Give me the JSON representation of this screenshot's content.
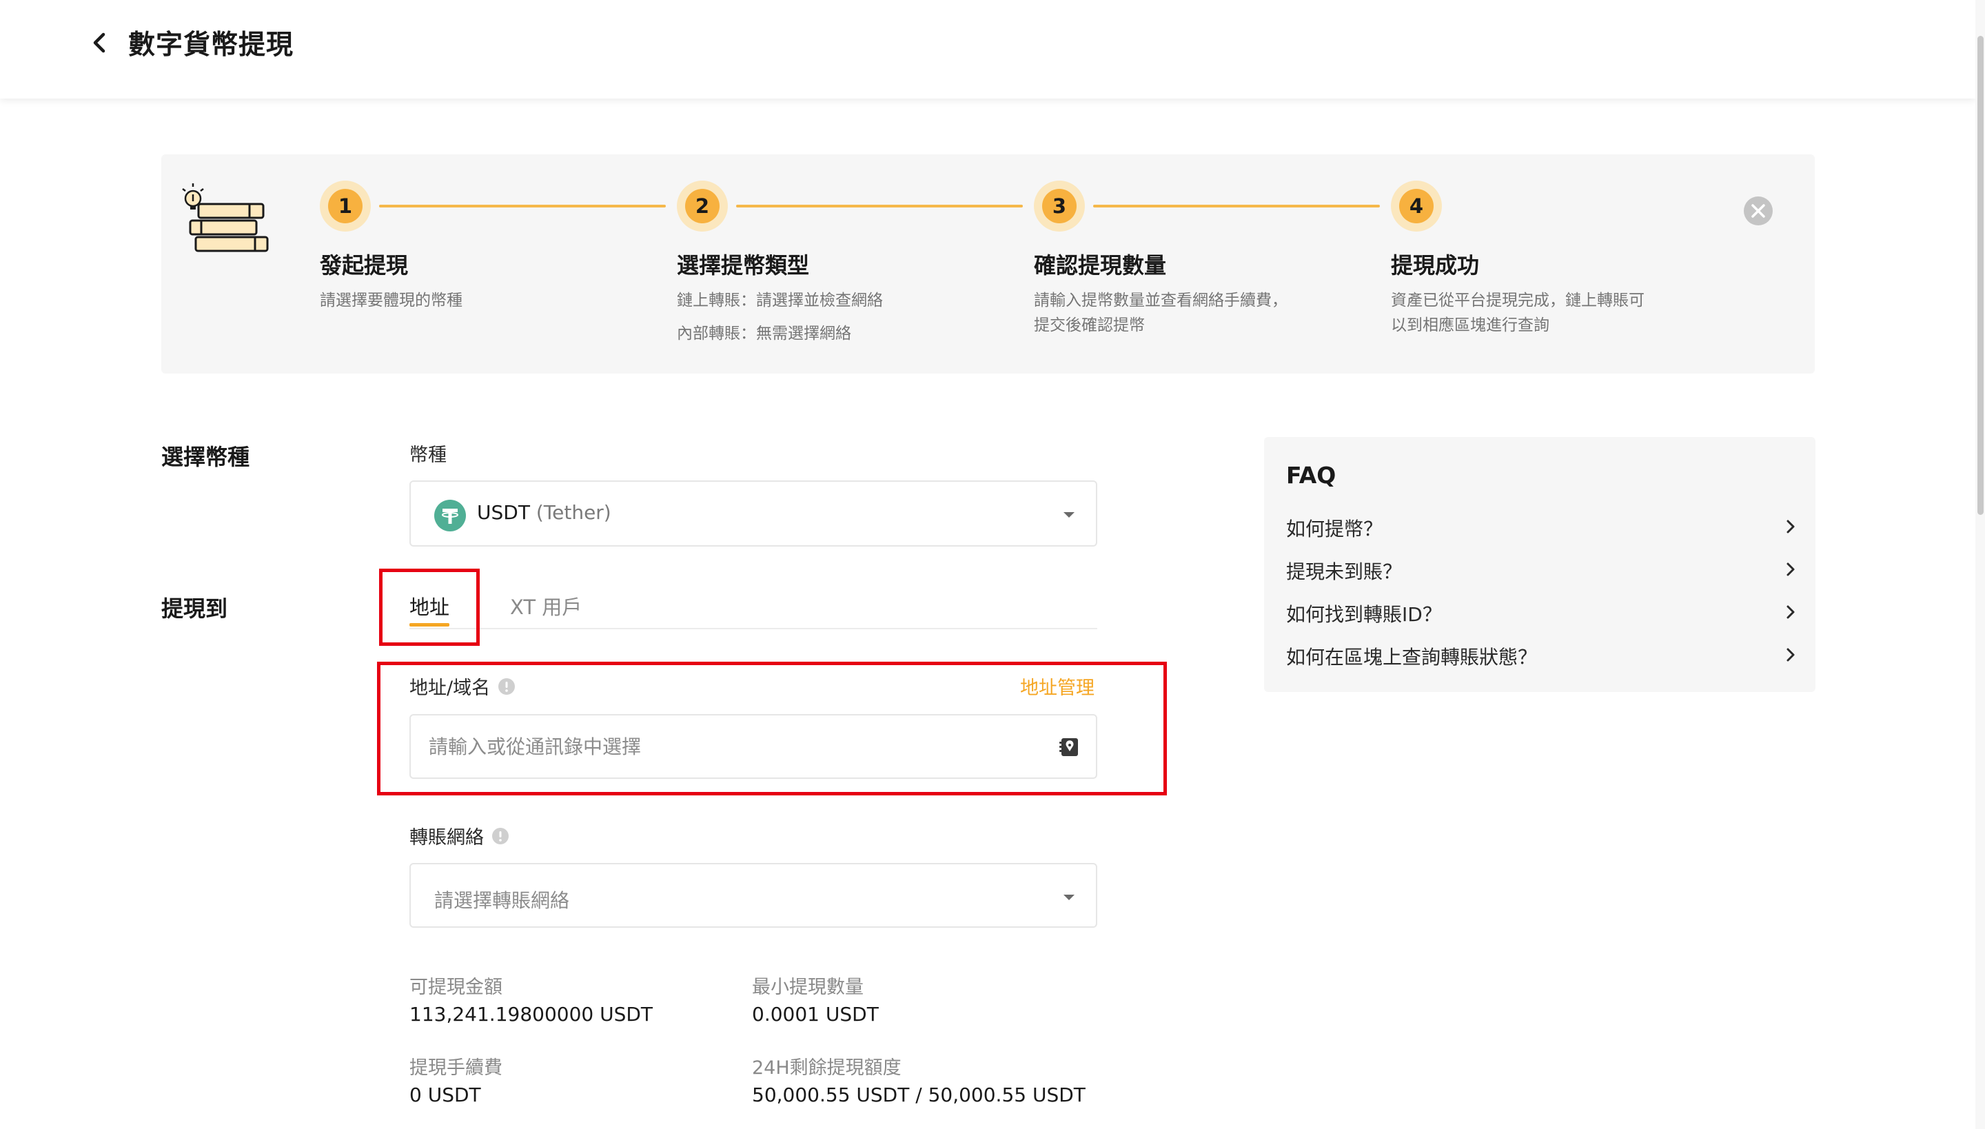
{
  "header": {
    "title": "數字貨幣提現",
    "back_icon": "chevron-left-icon"
  },
  "steps": {
    "items": [
      {
        "number": "1",
        "title": "發起提現",
        "desc": [
          "請選擇要體現的幣種"
        ]
      },
      {
        "number": "2",
        "title": "選擇提幣類型",
        "desc": [
          "鏈上轉賬：請選擇並檢查網絡",
          "內部轉賬：無需選擇網絡"
        ]
      },
      {
        "number": "3",
        "title": "確認提現數量",
        "desc": [
          "請輸入提幣數量並查看網絡手續費，",
          "提交後確認提幣"
        ]
      },
      {
        "number": "4",
        "title": "提現成功",
        "desc": [
          "資產已從平台提現完成，鏈上轉賬可",
          "以到相應區塊進行查詢"
        ]
      }
    ],
    "close_icon": "close-circle-icon",
    "accent_color": "#f5a623"
  },
  "coin_section": {
    "label": "選擇幣種",
    "field_label": "幣種",
    "selected_symbol": "USDT",
    "selected_name": "(Tether)",
    "coin_icon": "tether-icon",
    "coin_color": "#50af95"
  },
  "withdraw_to": {
    "label": "提現到",
    "tabs": [
      {
        "label": "地址",
        "active": true
      },
      {
        "label": "XT 用戶",
        "active": false
      }
    ],
    "address_label": "地址/域名",
    "address_manage": "地址管理",
    "address_placeholder": "請輸入或從通訊錄中選擇",
    "address_value": "",
    "network_label": "轉賬網絡",
    "network_placeholder": "請選擇轉賬網絡"
  },
  "info": {
    "available_label": "可提現金額",
    "available_value": "113,241.19800000 USDT",
    "min_label": "最小提現數量",
    "min_value": "0.0001 USDT",
    "fee_label": "提現手續費",
    "fee_value": "0 USDT",
    "remaining_label": "24H剩餘提現額度",
    "remaining_value": "50,000.55 USDT / 50,000.55 USDT"
  },
  "faq": {
    "title": "FAQ",
    "items": [
      {
        "label": "如何提幣？"
      },
      {
        "label": "提現未到賬？"
      },
      {
        "label": "如何找到轉賬ID？"
      },
      {
        "label": "如何在區塊上查詢轉賬狀態？"
      }
    ]
  },
  "highlight_color": "#e60012"
}
